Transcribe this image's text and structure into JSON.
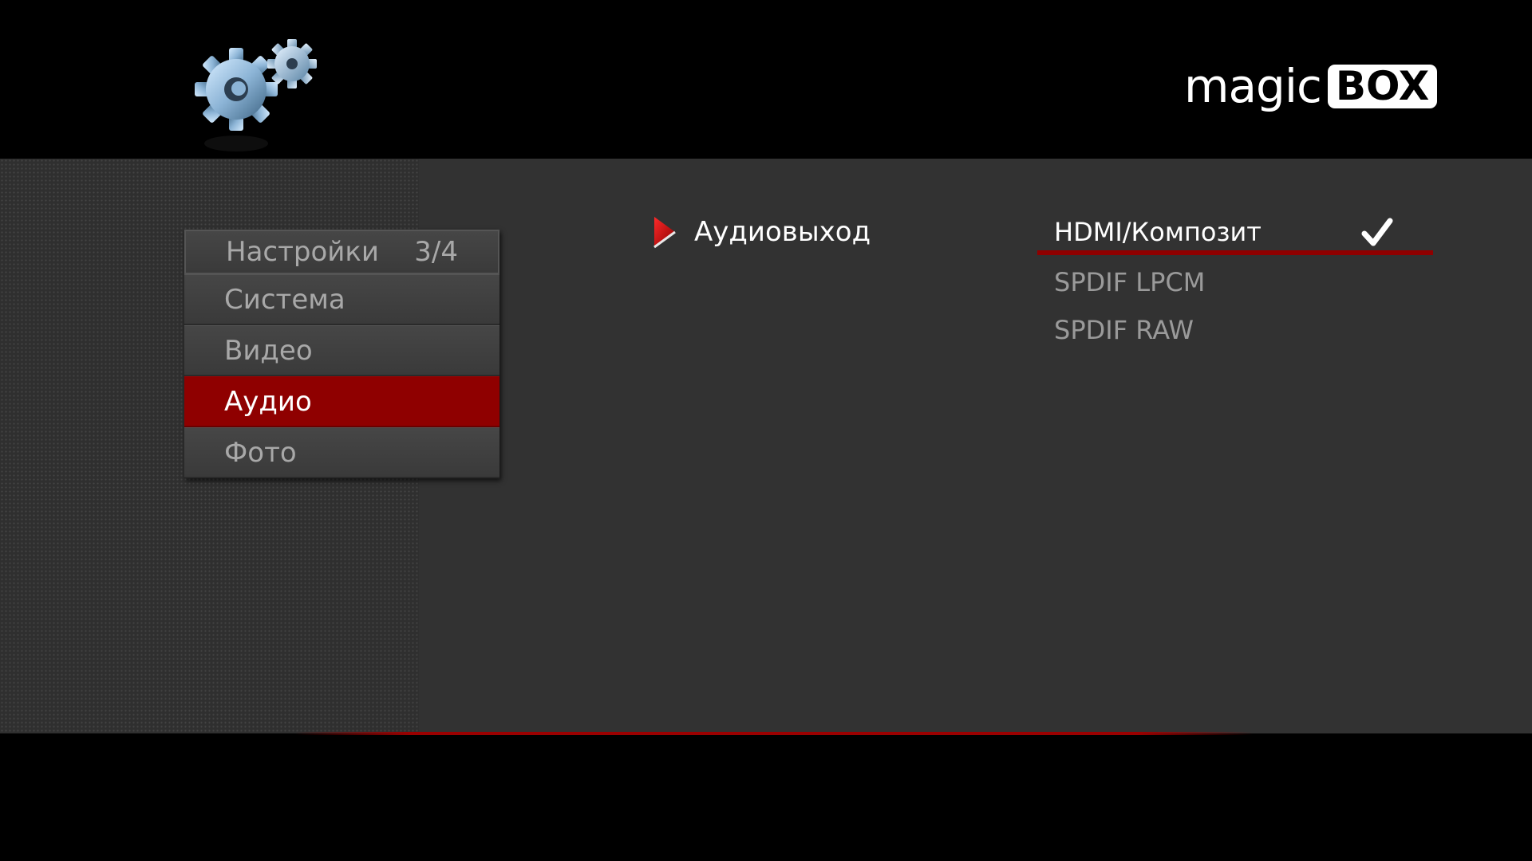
{
  "header": {
    "icon": "gears-icon",
    "logo": {
      "text_magic": "magic",
      "text_box": "BOX"
    }
  },
  "menu": {
    "title": "Настройки",
    "page": "3/4",
    "items": [
      {
        "label": "Система",
        "active": false
      },
      {
        "label": "Видео",
        "active": false
      },
      {
        "label": "Аудио",
        "active": true
      },
      {
        "label": "Фото",
        "active": false
      }
    ]
  },
  "parameter": {
    "label": "Аудиовыход",
    "icon": "play-arrow-icon"
  },
  "options": [
    {
      "label": "HDMI/Композит",
      "selected": true
    },
    {
      "label": "SPDIF LPCM",
      "selected": false
    },
    {
      "label": "SPDIF RAW",
      "selected": false
    }
  ],
  "colors": {
    "accent": "#8f0000",
    "panel": "#323232",
    "background": "#000000"
  }
}
